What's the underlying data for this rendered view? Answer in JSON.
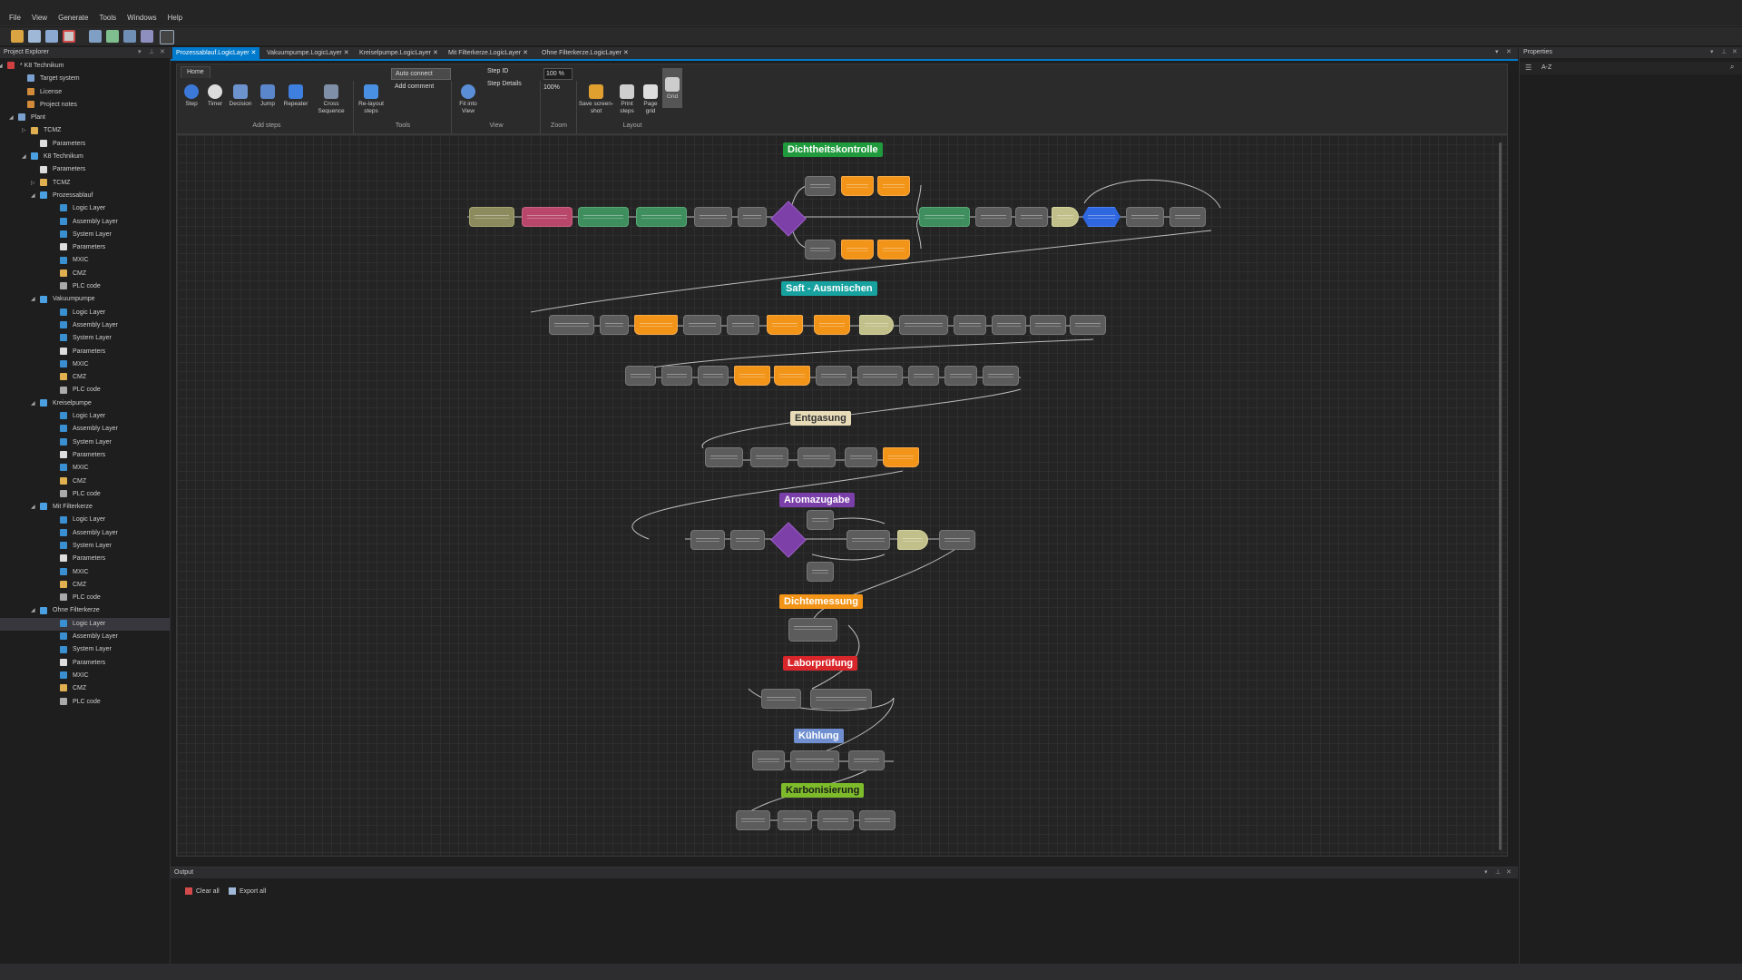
{
  "menu": [
    "File",
    "View",
    "Generate",
    "Tools",
    "Windows",
    "Help"
  ],
  "explorer": {
    "title": "Project Explorer",
    "items": [
      {
        "label": "* K8 Technikum",
        "color": "#d04040"
      },
      {
        "label": "Target system",
        "color": "#7aa0d0"
      },
      {
        "label": "License",
        "color": "#d08a3a"
      },
      {
        "label": "Project notes",
        "color": "#d08a3a"
      },
      {
        "label": "Plant",
        "color": "#7aa0d0"
      },
      {
        "label": "TCMZ",
        "color": "#e0b050"
      },
      {
        "label": "Parameters",
        "color": "#dddddd"
      },
      {
        "label": "K8 Technikum",
        "color": "#4aa0e0"
      },
      {
        "label": "Parameters",
        "color": "#dddddd"
      },
      {
        "label": "TCMZ",
        "color": "#e0b050"
      },
      {
        "label": "Prozessablauf",
        "color": "#4aa0e0"
      },
      {
        "label": "Logic Layer",
        "color": "#3a8fd0"
      },
      {
        "label": "Assembly Layer",
        "color": "#3a8fd0"
      },
      {
        "label": "System Layer",
        "color": "#3a8fd0"
      },
      {
        "label": "Parameters",
        "color": "#dddddd"
      },
      {
        "label": "MXIC",
        "color": "#3a8fd0"
      },
      {
        "label": "CMZ",
        "color": "#e0b050"
      },
      {
        "label": "PLC code",
        "color": "#aaaaaa"
      },
      {
        "label": "Vakuumpumpe",
        "color": "#4aa0e0"
      },
      {
        "label": "Logic Layer",
        "color": "#3a8fd0"
      },
      {
        "label": "Assembly Layer",
        "color": "#3a8fd0"
      },
      {
        "label": "System Layer",
        "color": "#3a8fd0"
      },
      {
        "label": "Parameters",
        "color": "#dddddd"
      },
      {
        "label": "MXIC",
        "color": "#3a8fd0"
      },
      {
        "label": "CMZ",
        "color": "#e0b050"
      },
      {
        "label": "PLC code",
        "color": "#aaaaaa"
      },
      {
        "label": "Kreiselpumpe",
        "color": "#4aa0e0"
      },
      {
        "label": "Logic Layer",
        "color": "#3a8fd0"
      },
      {
        "label": "Assembly Layer",
        "color": "#3a8fd0"
      },
      {
        "label": "System Layer",
        "color": "#3a8fd0"
      },
      {
        "label": "Parameters",
        "color": "#dddddd"
      },
      {
        "label": "MXIC",
        "color": "#3a8fd0"
      },
      {
        "label": "CMZ",
        "color": "#e0b050"
      },
      {
        "label": "PLC code",
        "color": "#aaaaaa"
      },
      {
        "label": "Mit Filterkerze",
        "color": "#4aa0e0"
      },
      {
        "label": "Logic Layer",
        "color": "#3a8fd0"
      },
      {
        "label": "Assembly Layer",
        "color": "#3a8fd0"
      },
      {
        "label": "System Layer",
        "color": "#3a8fd0"
      },
      {
        "label": "Parameters",
        "color": "#dddddd"
      },
      {
        "label": "MXIC",
        "color": "#3a8fd0"
      },
      {
        "label": "CMZ",
        "color": "#e0b050"
      },
      {
        "label": "PLC code",
        "color": "#aaaaaa"
      },
      {
        "label": "Ohne Filterkerze",
        "color": "#4aa0e0"
      },
      {
        "label": "Logic Layer",
        "color": "#3a8fd0"
      },
      {
        "label": "Assembly Layer",
        "color": "#3a8fd0"
      },
      {
        "label": "System Layer",
        "color": "#3a8fd0"
      },
      {
        "label": "Parameters",
        "color": "#dddddd"
      },
      {
        "label": "MXIC",
        "color": "#3a8fd0"
      },
      {
        "label": "CMZ",
        "color": "#e0b050"
      },
      {
        "label": "PLC code",
        "color": "#aaaaaa"
      }
    ]
  },
  "tabs": [
    "Prozessablauf.LogicLayer",
    "Vakuumpumpe.LogicLayer",
    "Kreiselpumpe.LogicLayer",
    "Mit Filterkerze.LogicLayer",
    "Ohne Filterkerze.LogicLayer"
  ],
  "ribbon": {
    "tab": "Home",
    "buttons": {
      "step": "Step",
      "timer": "Timer",
      "decision": "Decision",
      "jump": "Jump",
      "repeater": "Repeater",
      "cross_seq": "Cross Sequence",
      "relayout": "Re-layout steps",
      "auto_connect": "Auto connect",
      "add_comment": "Add comment",
      "fit": "Fit into View",
      "step_id": "Step ID",
      "step_details": "Step Details",
      "zoom_value": "100 %",
      "zoom_100": "100%",
      "screenshot": "Save screen-shot",
      "print": "Print steps",
      "page_grid": "Page grid",
      "grid": "Grid"
    },
    "groups": {
      "add_steps": "Add steps",
      "tools": "Tools",
      "view": "View",
      "zoom": "Zoom",
      "layout": "Layout"
    }
  },
  "sections": {
    "s1": "Dichtheitskontrolle",
    "s2": "Saft - Ausmischen",
    "s3": "Entgasung",
    "s4": "Aromazugabe",
    "s5": "Dichtemessung",
    "s6": "Laborprüfung",
    "s7": "Kühlung",
    "s8": "Karbonisierung"
  },
  "section_colors": {
    "s1": "#1f9a3c",
    "s2": "#17a2a0",
    "s3": "#e8dcb8",
    "s4": "#7a3fa8",
    "s5": "#f29418",
    "s6": "#d9262b",
    "s7": "#6f8fd0",
    "s8": "#7dbb2a"
  },
  "output": {
    "title": "Output",
    "clear": "Clear all",
    "export": "Export all"
  },
  "properties": {
    "title": "Properties",
    "sort": "A-Z"
  }
}
